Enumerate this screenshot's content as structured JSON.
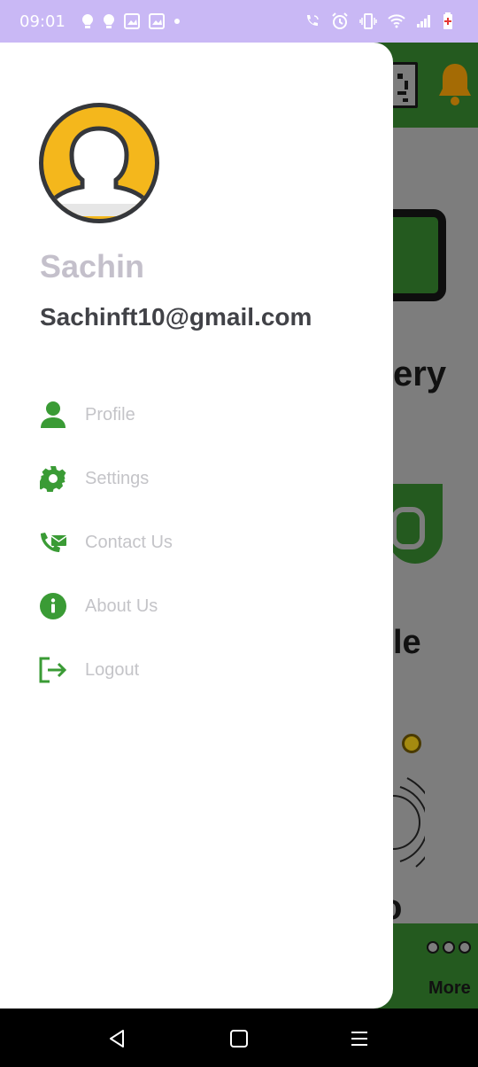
{
  "status_bar": {
    "time": "09:01",
    "left_icons": [
      "notification-icon",
      "notification-icon",
      "gallery-icon",
      "gallery-icon",
      "dot-icon"
    ],
    "right_icons": [
      "wifi-call-icon",
      "alarm-icon",
      "vibrate-icon",
      "wifi-icon",
      "signal-icon",
      "battery-icon"
    ]
  },
  "drawer": {
    "user": {
      "name": "Sachin",
      "email": "Sachinft10@gmail.com"
    },
    "menu": [
      {
        "label": "Profile",
        "icon": "person-icon"
      },
      {
        "label": "Settings",
        "icon": "gear-icon"
      },
      {
        "label": "Contact Us",
        "icon": "contact-mail-icon"
      },
      {
        "label": "About Us",
        "icon": "info-icon"
      },
      {
        "label": "Logout",
        "icon": "logout-icon"
      }
    ],
    "icon_color": "#3a9b35",
    "label_color": "#c4c4c8"
  },
  "background_app": {
    "text_1": "ery",
    "text_2": "le",
    "text_3": "o End",
    "more_label": "More",
    "accent": "#245a1f"
  },
  "nav_bar": {
    "buttons": [
      "back-icon",
      "home-icon",
      "recents-icon"
    ]
  }
}
